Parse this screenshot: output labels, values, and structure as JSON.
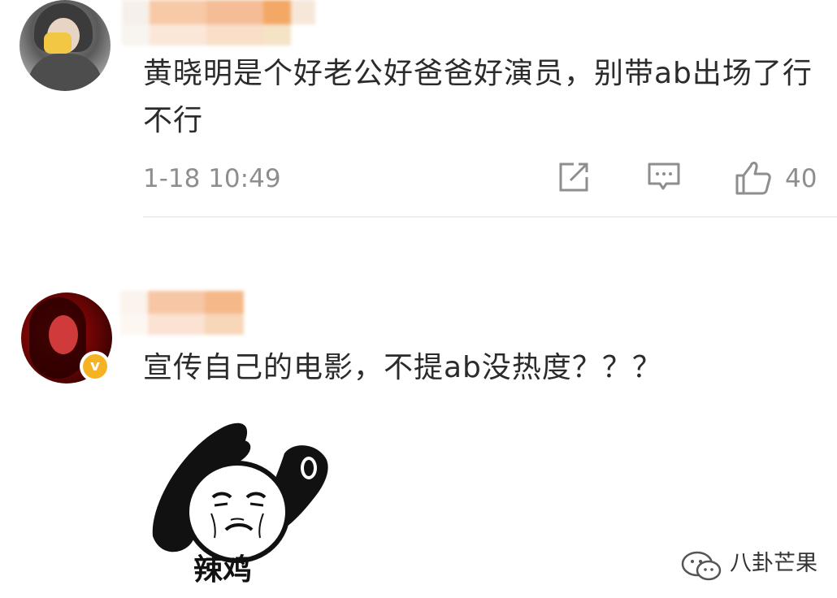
{
  "comments": [
    {
      "text": "黄晓明是个好老公好爸爸好演员，别带ab出场了行不行",
      "timestamp": "1-18 10:49",
      "likes": "40",
      "verified": false
    },
    {
      "text": "宣传自己的电影，不提ab没热度？？？",
      "verified": true
    }
  ],
  "sticker": {
    "caption": "辣鸡"
  },
  "watermark": {
    "text": "八卦芒果"
  },
  "colors": {
    "text": "#2b2b2b",
    "meta": "#8e8e8e",
    "verified_badge": "#f5b323",
    "username_mosaic": "#f3b98c"
  }
}
